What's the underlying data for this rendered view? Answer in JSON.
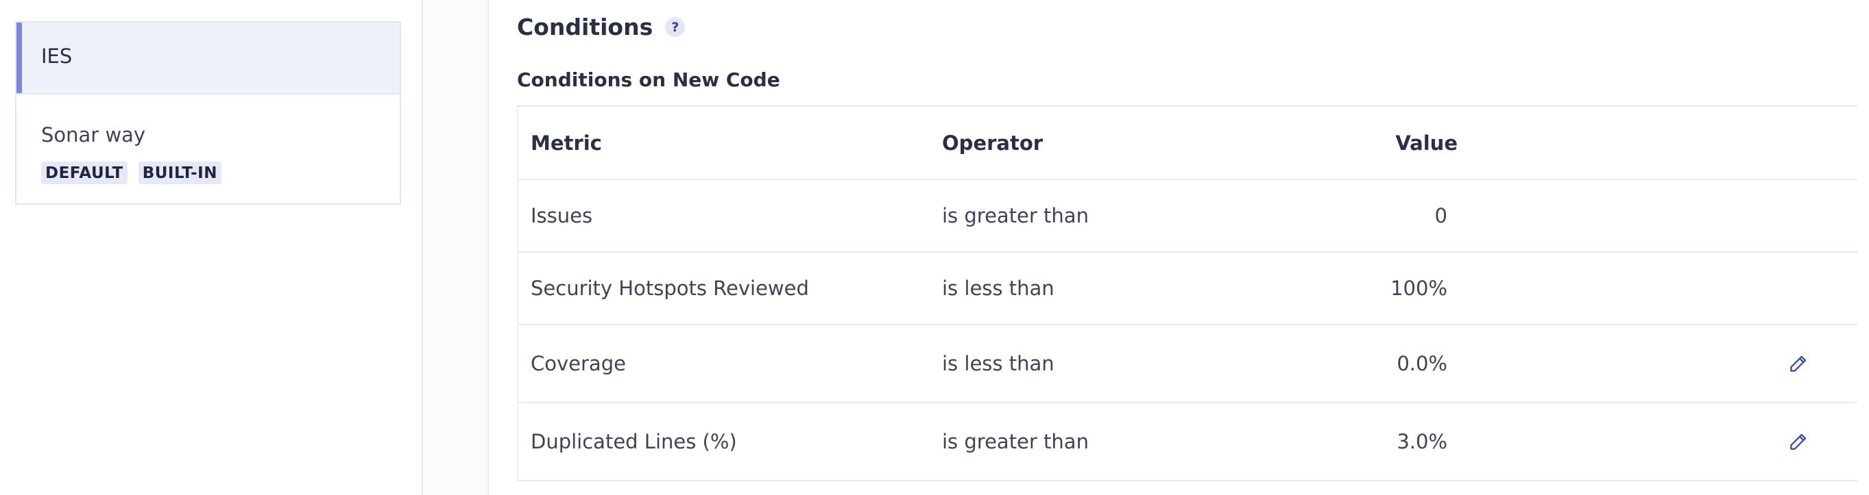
{
  "sidebar": {
    "gates": [
      {
        "name": "IES",
        "selected": true,
        "badges": []
      },
      {
        "name": "Sonar way",
        "selected": false,
        "badges": [
          "DEFAULT",
          "BUILT-IN"
        ]
      }
    ]
  },
  "main": {
    "title": "Conditions",
    "help_icon": "?",
    "section_title": "Conditions on New Code",
    "table": {
      "headers": {
        "metric": "Metric",
        "operator": "Operator",
        "value": "Value"
      },
      "rows": [
        {
          "metric": "Issues",
          "operator": "is greater than",
          "value": "0",
          "editable": false
        },
        {
          "metric": "Security Hotspots Reviewed",
          "operator": "is less than",
          "value": "100%",
          "editable": false
        },
        {
          "metric": "Coverage",
          "operator": "is less than",
          "value": "0.0%",
          "editable": true,
          "icon": "edit-icon"
        },
        {
          "metric": "Duplicated Lines (%)",
          "operator": "is greater than",
          "value": "3.0%",
          "editable": true,
          "icon": "edit-icon"
        }
      ]
    }
  },
  "colors": {
    "accent": "#7b87d9",
    "selected_bg": "#eef0fa",
    "edit_icon": "#3c4fb0"
  }
}
